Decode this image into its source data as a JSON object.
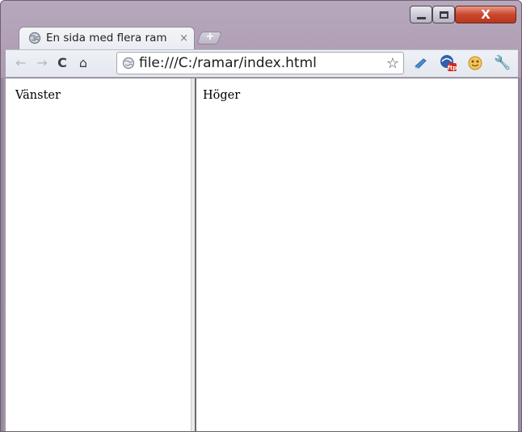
{
  "tab": {
    "title": "En sida med flera ram",
    "close": "×",
    "favicon": "globe-icon"
  },
  "window_controls": {
    "close": "X"
  },
  "toolbar": {
    "back": "←",
    "forward": "→",
    "reload": "C",
    "home": "⌂",
    "url": "file:///C:/ramar/index.html",
    "star": "☆",
    "wrench": "🔧",
    "extensions": [
      "blue-ext-icon",
      "ftp-icon",
      "smiley-icon"
    ]
  },
  "frames": {
    "left_text": "Vänster",
    "right_text": "Höger"
  },
  "colors": {
    "frame": "#a995ad",
    "close_button": "#c9472e",
    "toolbar": "#e9edf3"
  }
}
